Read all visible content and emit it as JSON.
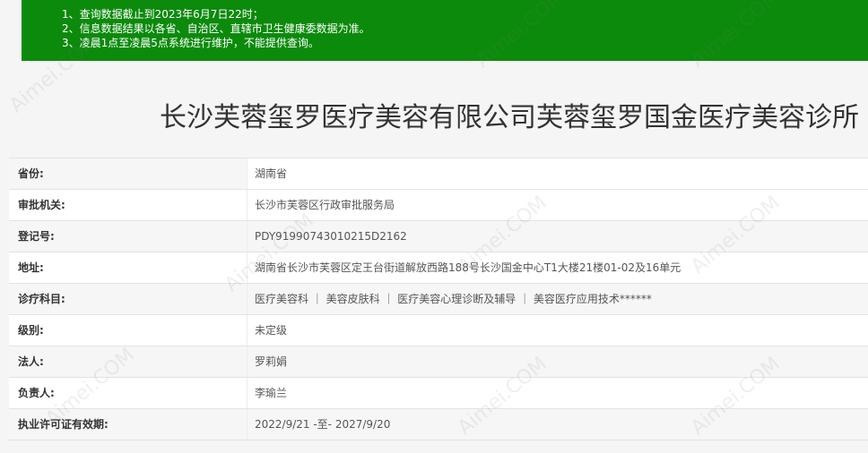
{
  "notice": {
    "lines": [
      "1、查询数据截止到2023年6月7日22时；",
      "2、信息数据结果以各省、自治区、直辖市卫生健康委数据为准。",
      "3、凌晨1点至凌晨5点系统进行维护，不能提供查询。"
    ]
  },
  "title": "长沙芙蓉玺罗医疗美容有限公司芙蓉玺罗国金医疗美容诊所",
  "rows": [
    {
      "label": "省份:",
      "value": "湖南省"
    },
    {
      "label": "审批机关:",
      "value": "长沙市芙蓉区行政审批服务局"
    },
    {
      "label": "登记号:",
      "value": "PDY91990743010215D2162"
    },
    {
      "label": "地址:",
      "value": "湖南省长沙市芙蓉区定王台街道解放西路188号长沙国金中心T1大楼21楼01-02及16单元"
    },
    {
      "label": "诊疗科目:",
      "value": "医疗美容科 ｜ 美容皮肤科 ｜ 医疗美容心理诊断及辅导 ｜ 美容医疗应用技术******"
    },
    {
      "label": "级别:",
      "value": "未定级"
    },
    {
      "label": "法人:",
      "value": "罗莉娟"
    },
    {
      "label": "负责人:",
      "value": "李瑜兰"
    },
    {
      "label": "执业许可证有效期:",
      "value": "2022/9/21 -至- 2027/9/20"
    }
  ],
  "watermark": "Aimei.COM"
}
